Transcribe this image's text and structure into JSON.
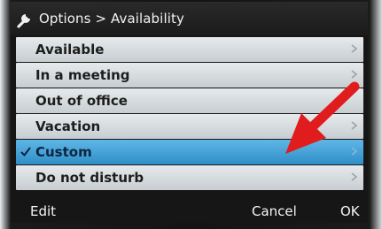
{
  "titlebar": {
    "breadcrumb": "Options > Availability",
    "icon": "wrench-icon"
  },
  "menu": {
    "items": [
      {
        "label": "Available",
        "selected": false
      },
      {
        "label": "In a meeting",
        "selected": false
      },
      {
        "label": "Out of office",
        "selected": false
      },
      {
        "label": "Vacation",
        "selected": false
      },
      {
        "label": "Custom",
        "selected": true
      },
      {
        "label": "Do not disturb",
        "selected": false
      }
    ]
  },
  "softkeys": {
    "left": "Edit",
    "middle": "Cancel",
    "right": "OK"
  },
  "annotation": {
    "arrow_color": "#e01c1c",
    "target": "Custom"
  },
  "colors": {
    "selected_row": "#3aa0d6",
    "row": "#d6dbde",
    "titlebar": "#222222"
  }
}
